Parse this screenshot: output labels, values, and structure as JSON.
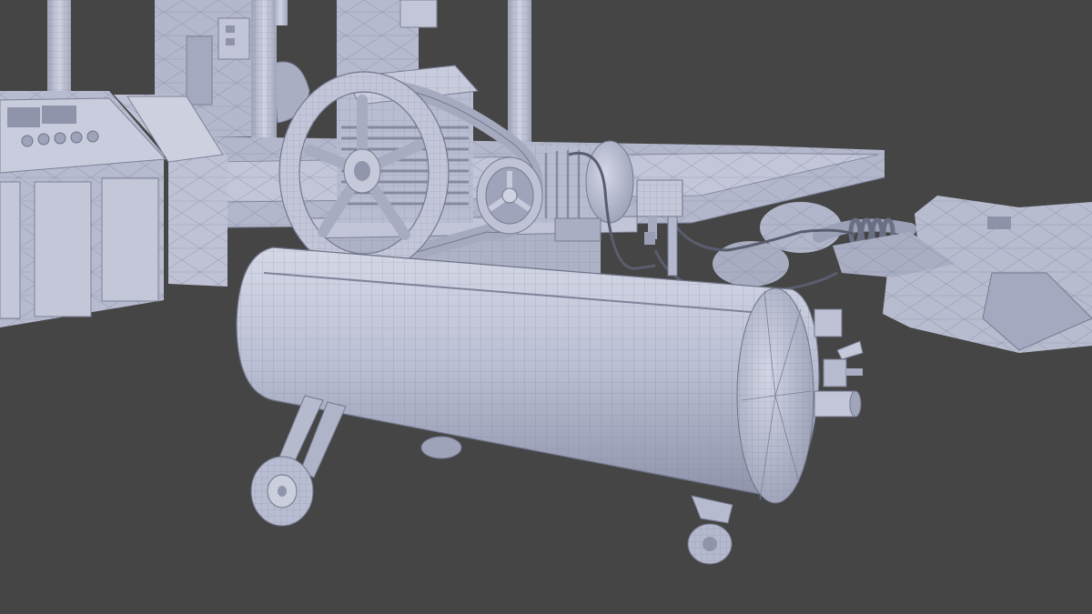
{
  "scene": {
    "background_color": "#454545",
    "model_color": "#b9bdd2",
    "model_shadow_color": "#8b90a8",
    "model_highlight_color": "#d9dbe8",
    "wire_color": "#6f7488",
    "objects": [
      "control-console",
      "steel-column",
      "elevated-platform",
      "industrial-machine",
      "air-compressor",
      "flywheel",
      "drive-belt",
      "electric-motor",
      "air-tank",
      "wheel",
      "caster-wheel",
      "pressure-switch",
      "coiled-hose",
      "pipe-fittings"
    ]
  }
}
